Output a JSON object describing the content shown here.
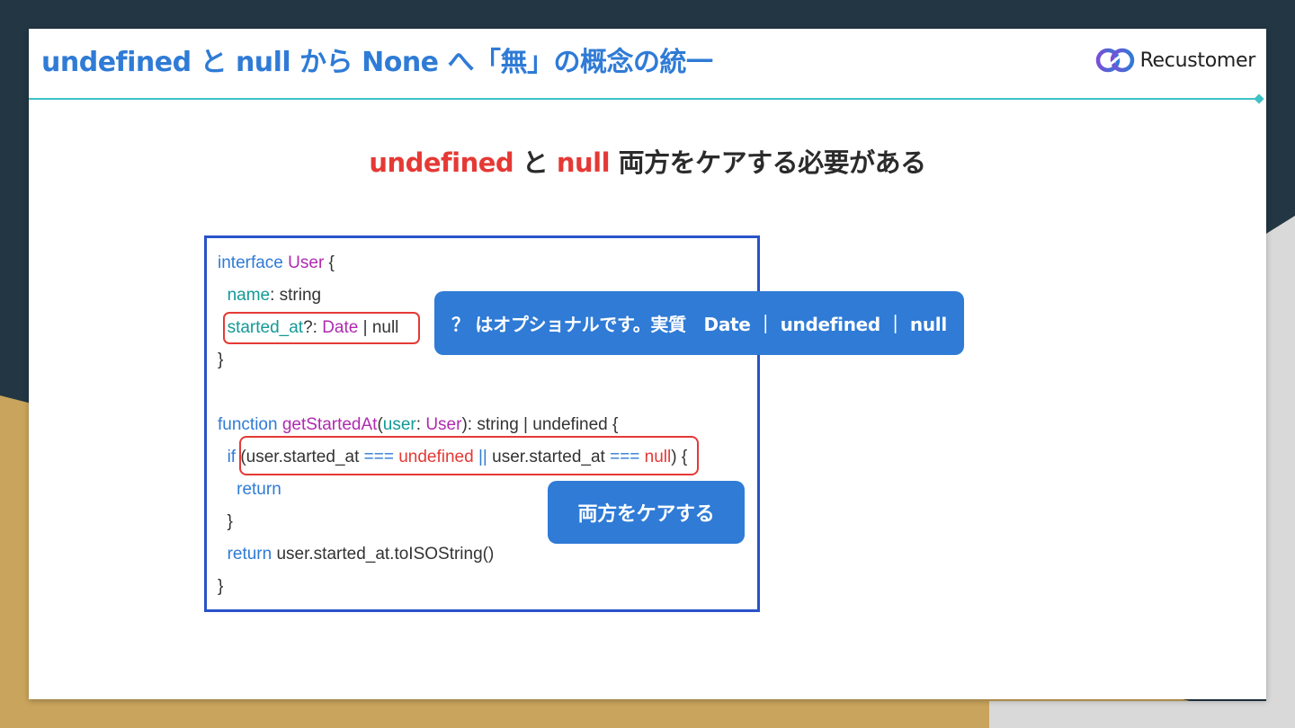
{
  "header": {
    "title": "undefined と null から None へ「無」の概念の統一",
    "logo_text": "Recustomer"
  },
  "subtitle": {
    "part1": "undefined",
    "part2": " と ",
    "part3": "null",
    "part4": " 両方をケアする必要がある"
  },
  "code": {
    "l1": {
      "a": "interface",
      "b": " ",
      "c": "User",
      "d": " {"
    },
    "l2": {
      "a": "  ",
      "b": "name",
      "c": ": string"
    },
    "l3": {
      "a": "  ",
      "b": "started_at",
      "c": "?: ",
      "d": "Date",
      "e": " | null"
    },
    "l4": {
      "a": "}"
    },
    "l6": {
      "a": "function",
      "b": " ",
      "c": "getStartedAt",
      "d": "(",
      "e": "user",
      "f": ": ",
      "g": "User",
      "h": "): string | undefined {"
    },
    "l7": {
      "a": "  ",
      "b": "if",
      "c": " (user.started_at ",
      "d": "===",
      "e": " ",
      "f": "undefined",
      "g": " ",
      "h": "||",
      "i": " user.started_at ",
      "j": "===",
      "k": " ",
      "l": "null",
      "m": ") {"
    },
    "l8": {
      "a": "    ",
      "b": "return"
    },
    "l9": {
      "a": "  }"
    },
    "l10": {
      "a": "  ",
      "b": "return",
      "c": " user.started_at.toISOString()"
    },
    "l11": {
      "a": "}"
    }
  },
  "callouts": {
    "optional_note": "？ はオプショナルです。実質　Date ｜ undefined ｜ null",
    "care_both": "両方をケアする"
  },
  "colors": {
    "accent_blue": "#2f7bd6",
    "highlight_red": "#e53935",
    "divider_teal": "#3fc2c6",
    "frame_blue": "#2a52c9"
  }
}
